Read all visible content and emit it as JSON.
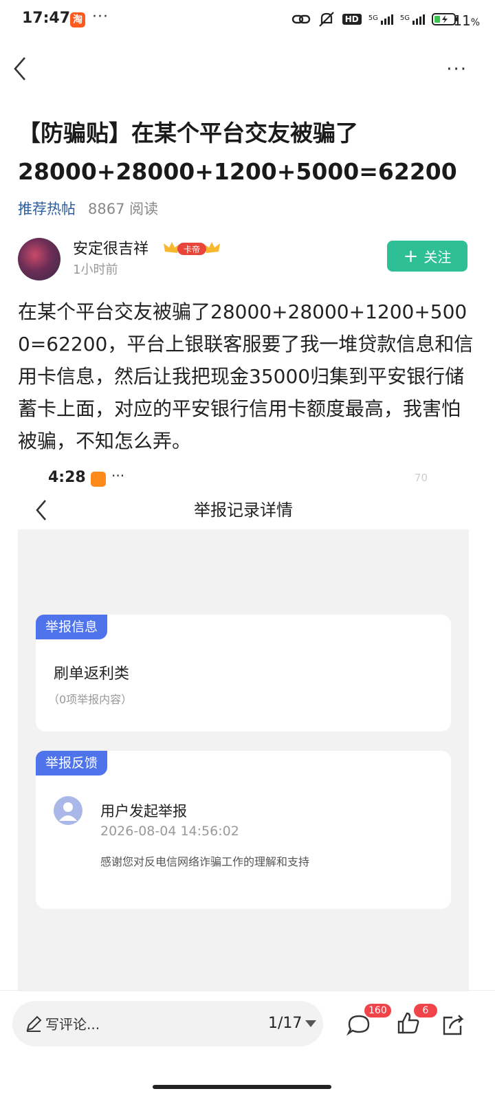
{
  "status_bar": {
    "time": "17:47",
    "app_badge": "淘",
    "dots": "···",
    "battery_pct": "11",
    "battery_unit": "%",
    "hd_label": "HD",
    "net_1": "5G",
    "net_2": "5G"
  },
  "nav": {
    "more": "···"
  },
  "post": {
    "title": "【防骗贴】在某个平台交友被骗了28000+28000+1200+5000=62200",
    "tag": "推荐热帖",
    "reads": "8867 阅读",
    "body": "在某个平台交友被骗了28000+28000+1200+5000=62200，平台上银联客服要了我一堆贷款信息和信用卡信息，然后让我把现金35000归集到平安银行储蓄卡上面，对应的平安银行信用卡额度最高，我害怕被骗，不知怎么弄。"
  },
  "author": {
    "name": "安定很吉祥",
    "badge": "卡帝",
    "time": "1小时前",
    "follow_label": "关注"
  },
  "embedded_screenshot": {
    "time": "4:28",
    "dots": "···",
    "battery": "70",
    "title": "举报记录详情",
    "card1": {
      "tab": "举报信息",
      "type": "刷单返利类",
      "count": "（0项举报内容）"
    },
    "card2": {
      "tab": "举报反馈",
      "user_action": "用户发起举报",
      "timestamp": "2026-08-04 14:56:02",
      "thanks": "感谢您对反电信网络诈骗工作的理解和支持"
    }
  },
  "bottom_bar": {
    "comment_placeholder": "写评论...",
    "page_indicator": "1/17",
    "comment_count": "160",
    "like_count": "6"
  },
  "colors": {
    "accent_green": "#2fbf96",
    "tag_blue": "#2c5e9e",
    "report_tab_blue": "#4f73ea",
    "badge_red": "#f0444a"
  },
  "icons": [
    "back-arrow-icon",
    "more-icon",
    "plus-icon",
    "pen-icon",
    "comment-icon",
    "like-icon",
    "share-icon",
    "user-avatar-icon"
  ]
}
